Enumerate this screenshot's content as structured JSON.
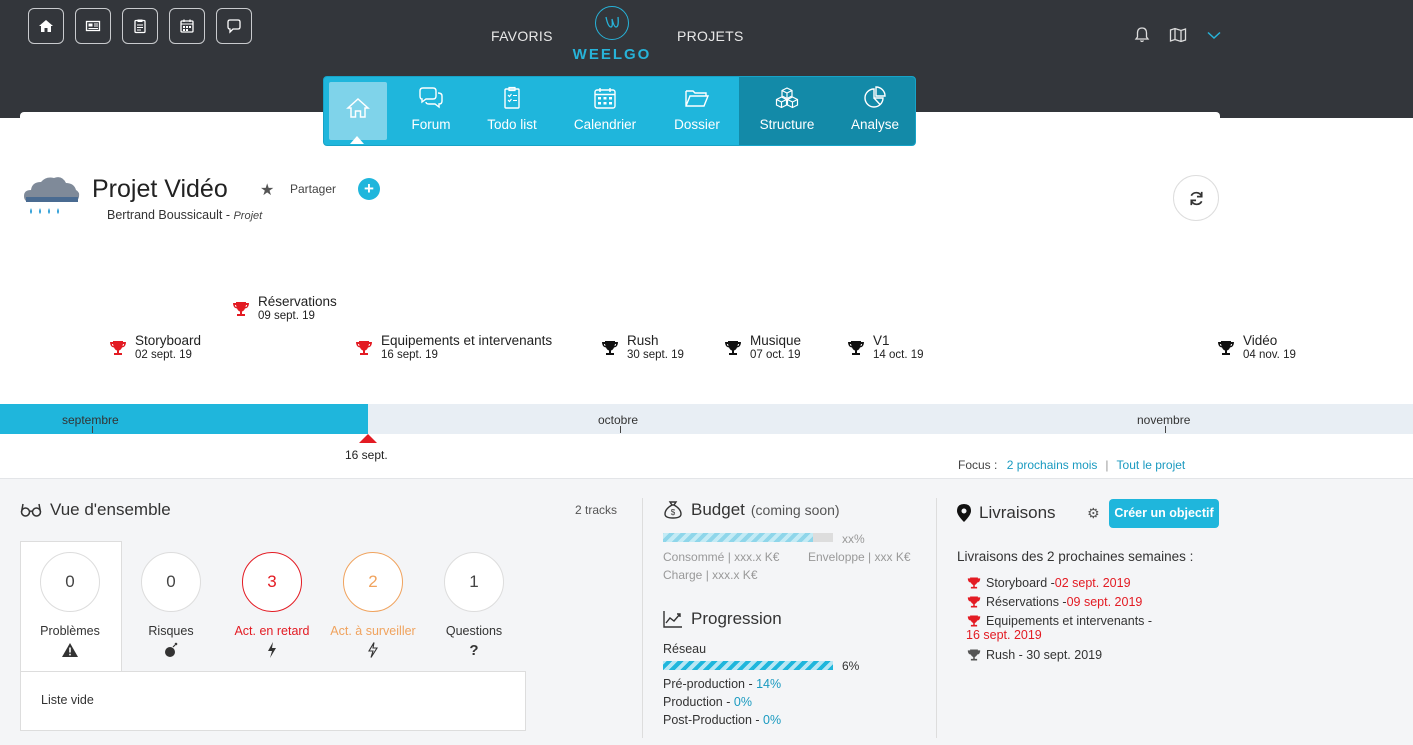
{
  "topnav": {
    "favoris": "FAVORIS",
    "projets": "PROJETS",
    "logo": "WEELGO"
  },
  "modules": [
    "Forum",
    "Todo list",
    "Calendrier",
    "Dossier",
    "Structure",
    "Analyse"
  ],
  "project": {
    "title": "Projet Vidéo",
    "share": "Partager",
    "owner": "Bertrand Boussicault",
    "owner_sep": " - ",
    "type": "Projet"
  },
  "milestones": [
    {
      "title": "Réservations",
      "date": "09 sept. 19",
      "late": true
    },
    {
      "title": "Storyboard",
      "date": "02 sept. 19",
      "late": true
    },
    {
      "title": "Equipements et intervenants",
      "date": "16 sept. 19",
      "late": true
    },
    {
      "title": "Rush",
      "date": "30 sept. 19",
      "late": false
    },
    {
      "title": "Musique",
      "date": "07 oct. 19",
      "late": false
    },
    {
      "title": "V1",
      "date": "14 oct. 19",
      "late": false
    },
    {
      "title": "Vidéo",
      "date": "04 nov. 19",
      "late": false
    }
  ],
  "timeline": {
    "months": [
      "septembre",
      "octobre",
      "novembre"
    ],
    "today": "16 sept.",
    "focus_label": "Focus :",
    "focus_options": [
      "2 prochains mois",
      "Tout le projet"
    ]
  },
  "overview": {
    "title": "Vue d'ensemble",
    "tracks": "2 tracks",
    "cards": [
      {
        "value": "0",
        "label": "Problèmes",
        "color": "#333333"
      },
      {
        "value": "0",
        "label": "Risques",
        "color": "#333333"
      },
      {
        "value": "3",
        "label": "Act. en retard",
        "color": "#e31b23"
      },
      {
        "value": "2",
        "label": "Act. à surveiller",
        "color": "#f0a35e"
      },
      {
        "value": "1",
        "label": "Questions",
        "color": "#333333"
      }
    ],
    "empty": "Liste vide"
  },
  "budget": {
    "title": "Budget",
    "soon": "(coming soon)",
    "pct": "xx%",
    "consumed": "Consommé | xxx.x K€",
    "envelope": "Enveloppe | xxx K€",
    "charge": "Charge | xxx.x K€"
  },
  "progression": {
    "title": "Progression",
    "network": "Réseau",
    "network_pct": "6%",
    "network_value": 0.06,
    "phases": [
      {
        "label": "Pré-production - ",
        "pct": "14%"
      },
      {
        "label": "Production - ",
        "pct": "0%"
      },
      {
        "label": "Post-Production - ",
        "pct": "0%"
      }
    ]
  },
  "livraisons": {
    "title": "Livraisons",
    "create": "Créer un objectif",
    "subtitle": "Livraisons des 2 prochaines semaines :",
    "items": [
      {
        "label": "Storyboard - ",
        "date": "02 sept. 2019",
        "late": true
      },
      {
        "label": "Réservations - ",
        "date": "09 sept. 2019",
        "late": true
      },
      {
        "label": "Equipements et intervenants - ",
        "date": "16 sept. 2019",
        "late": true
      },
      {
        "label": "Rush - 30 sept. 2019",
        "date": "",
        "late": false
      }
    ]
  },
  "colors": {
    "accent": "#1fb6dc",
    "late": "#e31b23",
    "watch": "#f0a35e",
    "topbar": "#33363b"
  }
}
